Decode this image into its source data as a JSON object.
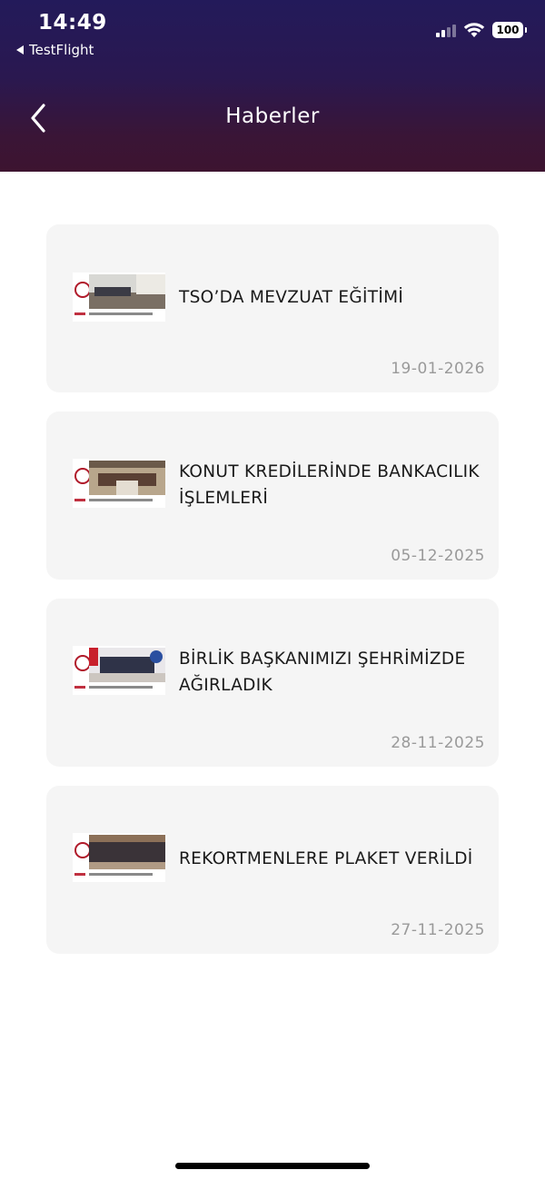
{
  "status_bar": {
    "time": "14:49",
    "back_app": "TestFlight",
    "battery": "100",
    "icons": [
      "signal-icon",
      "wifi-icon",
      "battery-icon"
    ]
  },
  "nav": {
    "title": "Haberler",
    "back_icon": "chevron-left-icon"
  },
  "news": [
    {
      "title": "TSO’DA MEVZUAT EĞİTİMİ",
      "date": "19-01-2026"
    },
    {
      "title": "KONUT KREDİLERİNDE BANKACILIK İŞLEMLERİ",
      "date": "05-12-2025"
    },
    {
      "title": "BİRLİK BAŞKANIMIZI ŞEHRİMİZDE AĞIRLADIK",
      "date": "28-11-2025"
    },
    {
      "title": "REKORTMENLERE PLAKET VERİLDİ",
      "date": "27-11-2025"
    }
  ],
  "colors": {
    "header_top": "#231a5a",
    "header_bottom": "#3d1430",
    "card_bg": "#f5f5f5",
    "date_text": "#9a9a9a"
  }
}
